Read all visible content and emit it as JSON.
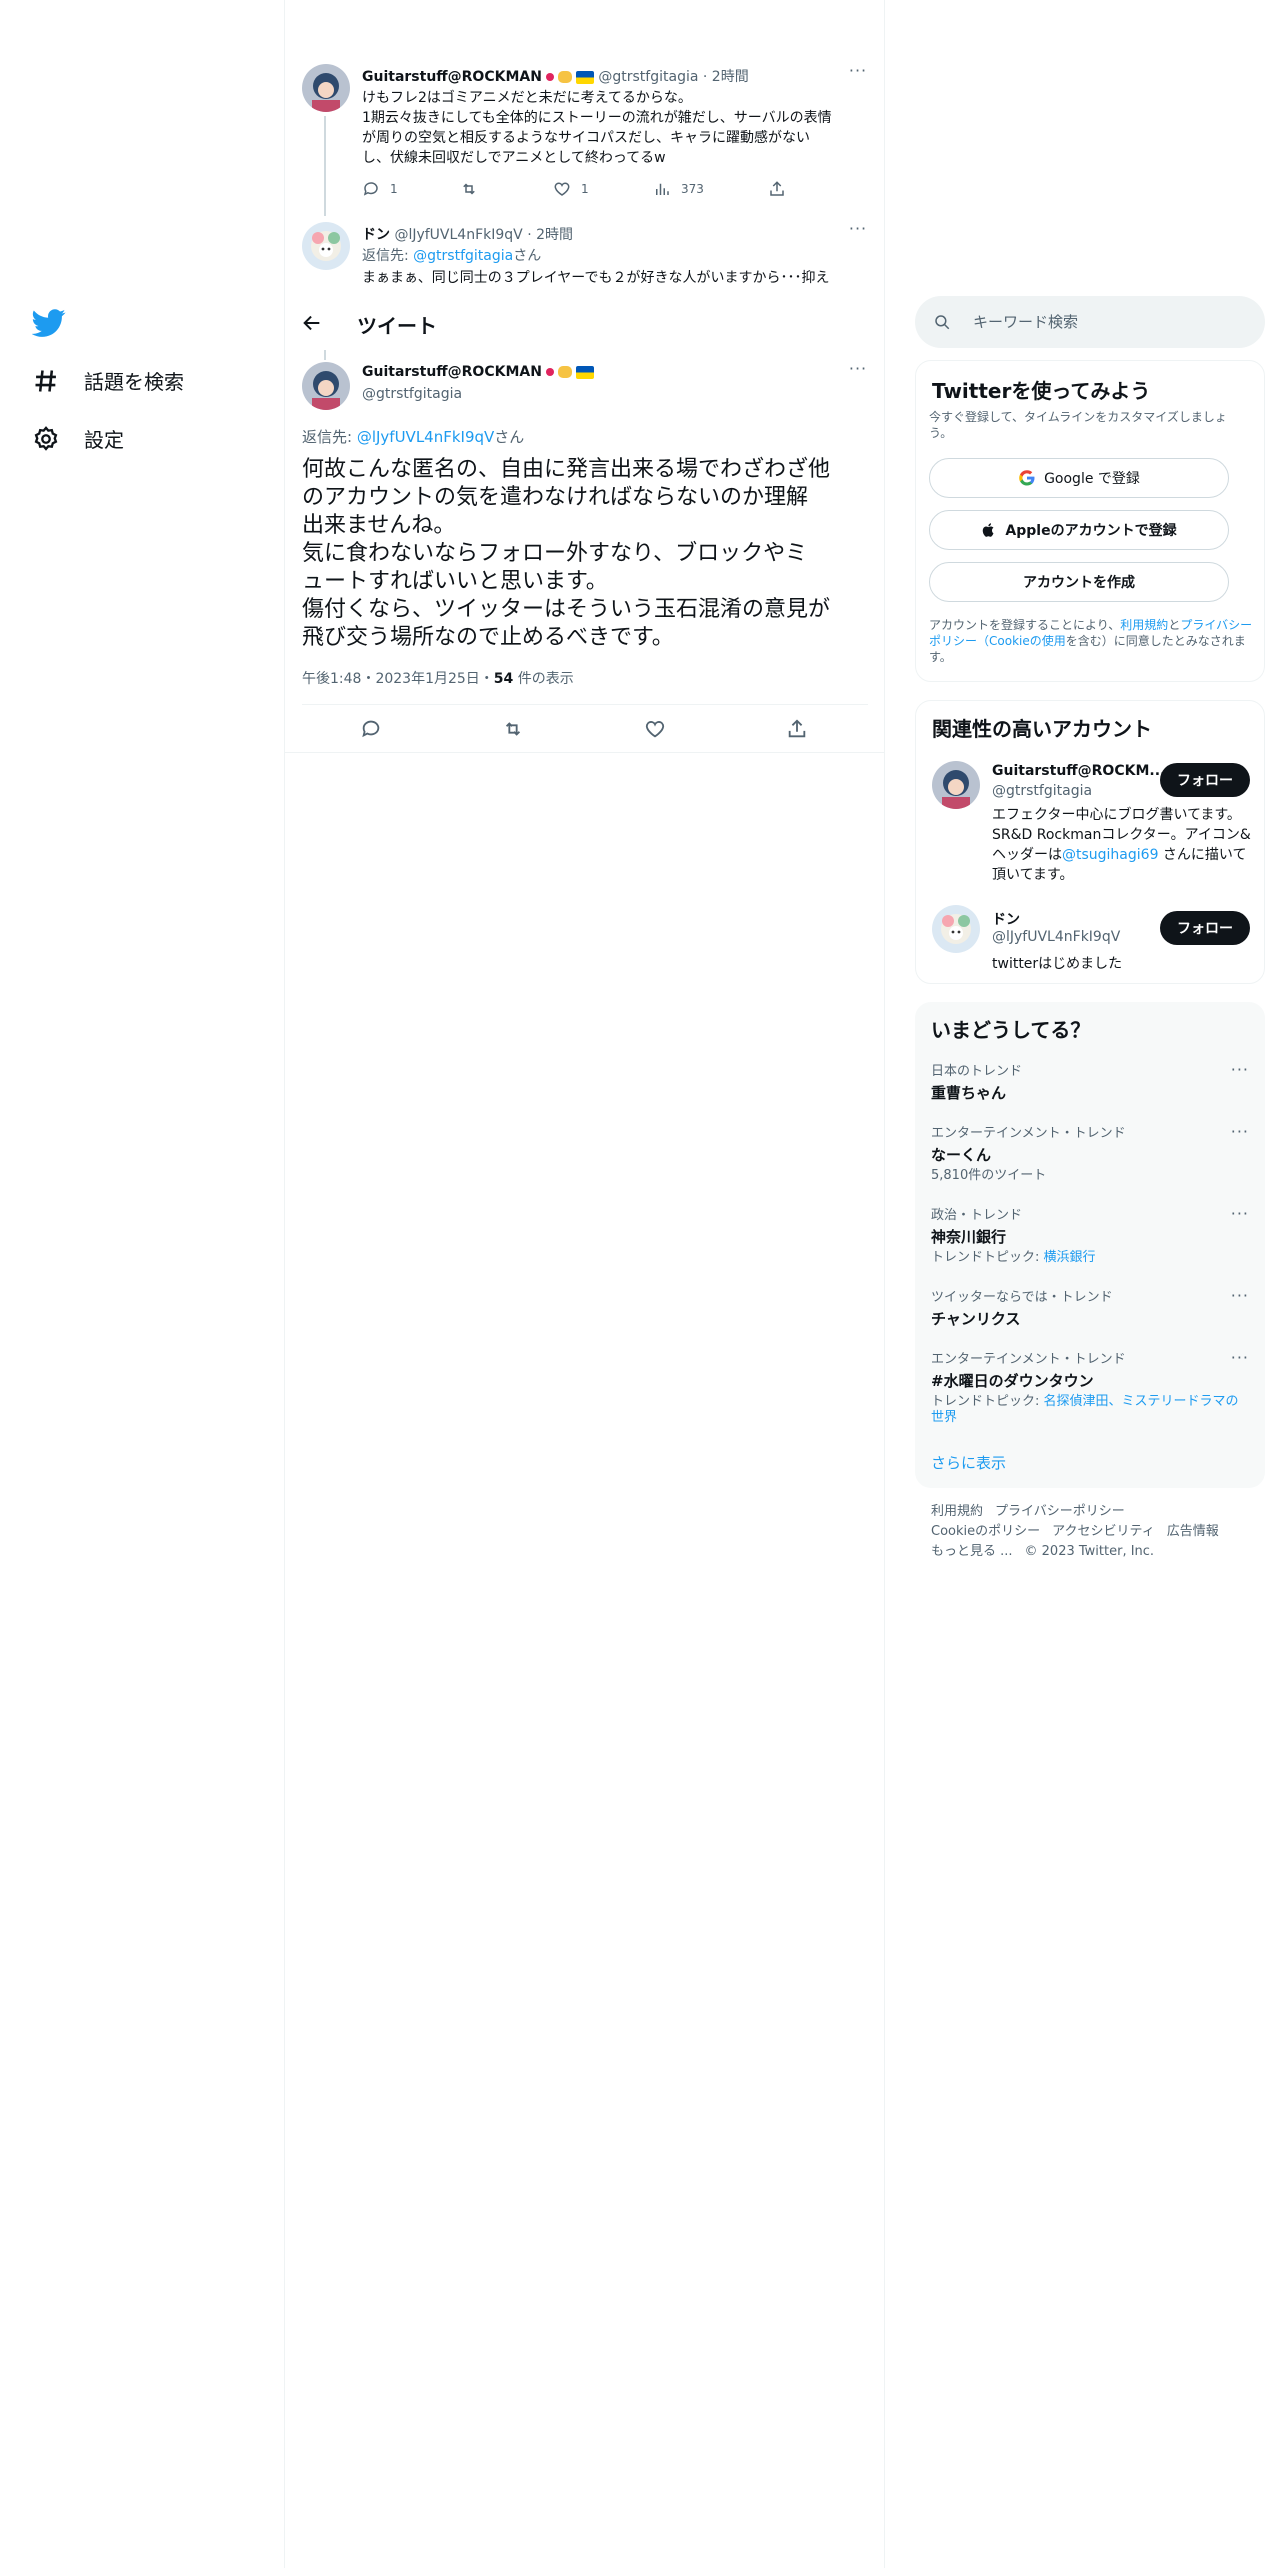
{
  "nav": {
    "explore_label": "話題を検索",
    "settings_label": "設定"
  },
  "thread": {
    "tweet1": {
      "name": "Guitarstuff@ROCKMAN",
      "handle": "@gtrstfgitagia",
      "time": "2時間",
      "lines": [
        "けもフレ2はゴミアニメだと未だに考えてるからな。",
        "1期云々抜きにしても全体的にストーリーの流れが雑だし、サーバルの表情",
        "が周りの空気と相反するようなサイコパスだし、キャラに躍動感がない",
        "し、伏線未回収だしでアニメとして終わってるw"
      ],
      "replies": "1",
      "likes": "1",
      "views": "373"
    },
    "tweet2": {
      "name": "ドン",
      "handle": "@lJyfUVL4nFkI9qV",
      "time": "2時間",
      "reply_prefix": "返信先: ",
      "reply_to": "@gtrstfgitagia",
      "reply_suffix": "さん",
      "text": "まぁまぁ、同じ同士の３プレイヤーでも２が好きな人がいますから･･･抑え"
    }
  },
  "header": {
    "title": "ツイート"
  },
  "main_tweet": {
    "name": "Guitarstuff@ROCKMAN",
    "handle": "@gtrstfgitagia",
    "reply_prefix": "返信先: ",
    "reply_to": "@lJyfUVL4nFkI9qV",
    "reply_suffix": "さん",
    "lines": [
      "何故こんな匿名の、自由に発言出来る場でわざわざ他",
      "のアカウントの気を遣わなければならないのか理解",
      "出来ませんね。",
      "気に食わないならフォロー外すなり、ブロックやミ",
      "ュートすればいいと思います。",
      "傷付くなら、ツイッターはそういう玉石混淆の意見が",
      "飛び交う場所なので止めるべきです。"
    ],
    "timestamp": "午後1:48・2023年1月25日・",
    "views_count": "54",
    "views_label": " 件の表示"
  },
  "search": {
    "placeholder": "キーワード検索"
  },
  "signup": {
    "title": "Twitterを使ってみよう",
    "subtitle": "今すぐ登録して、タイムラインをカスタマイズしましょう。",
    "google_label": "Google で登録",
    "apple_label": "Appleのアカウントで登録",
    "create_label": "アカウントを作成",
    "terms_prefix": "アカウントを登録することにより、",
    "terms_link": "利用規約",
    "terms_and": "と",
    "privacy_link": "プライバシーポリシー（Cookieの使用",
    "terms_suffix": "を含む）に同意したとみなされます。"
  },
  "related": {
    "title": "関連性の高いアカウント",
    "accounts": [
      {
        "name": "Guitarstuff@ROCKM...",
        "handle": "@gtrstfgitagia",
        "bio_1": "エフェクター中心にブログ書いてます。 SR&D Rockmanコレクター。ア",
        "bio_2": "イコン&ヘッダーは",
        "bio_link": "@tsugihagi69",
        "bio_3": " さんに描いて頂いてます。",
        "follow_label": "フォロー"
      },
      {
        "name": "ドン",
        "handle": "@lJyfUVL4nFkI9qV",
        "bio": "twitterはじめました",
        "follow_label": "フォロー"
      }
    ]
  },
  "trends": {
    "title": "いまどうしてる？",
    "items": [
      {
        "meta": "日本のトレンド",
        "title": "重曹ちゃん",
        "sub": ""
      },
      {
        "meta": "エンターテインメント・トレンド",
        "title": "なーくん",
        "sub": "5,810件のツイート"
      },
      {
        "meta": "政治・トレンド",
        "title": "神奈川銀行",
        "sub_prefix": "トレンドトピック: ",
        "sub_link": "横浜銀行"
      },
      {
        "meta": "ツイッターならでは・トレンド",
        "title": "チャンリクス",
        "sub": ""
      },
      {
        "meta": "エンターテインメント・トレンド",
        "title": "#水曜日のダウンタウン",
        "sub_prefix": "トレンドトピック: ",
        "sub_link": "名探偵津田、ミステリードラマの世界"
      }
    ],
    "show_more": "さらに表示"
  },
  "footer": {
    "terms": "利用規約",
    "privacy": "プライバシーポリシー",
    "cookie": "Cookieのポリシー",
    "accessibility": "アクセシビリティ",
    "ads": "広告情報",
    "more": "もっと見る ...",
    "copyright": "© 2023 Twitter, Inc."
  },
  "colors": {
    "accent": "#1d9bf0",
    "text": "#0f1419",
    "muted": "#536471",
    "border": "#eff3f4"
  },
  "icons": [
    "twitter-logo-icon",
    "hashtag-icon",
    "gear-icon",
    "back-arrow-icon",
    "reply-icon",
    "retweet-icon",
    "like-icon",
    "views-icon",
    "share-icon",
    "search-icon",
    "google-icon",
    "apple-icon",
    "more-icon"
  ]
}
